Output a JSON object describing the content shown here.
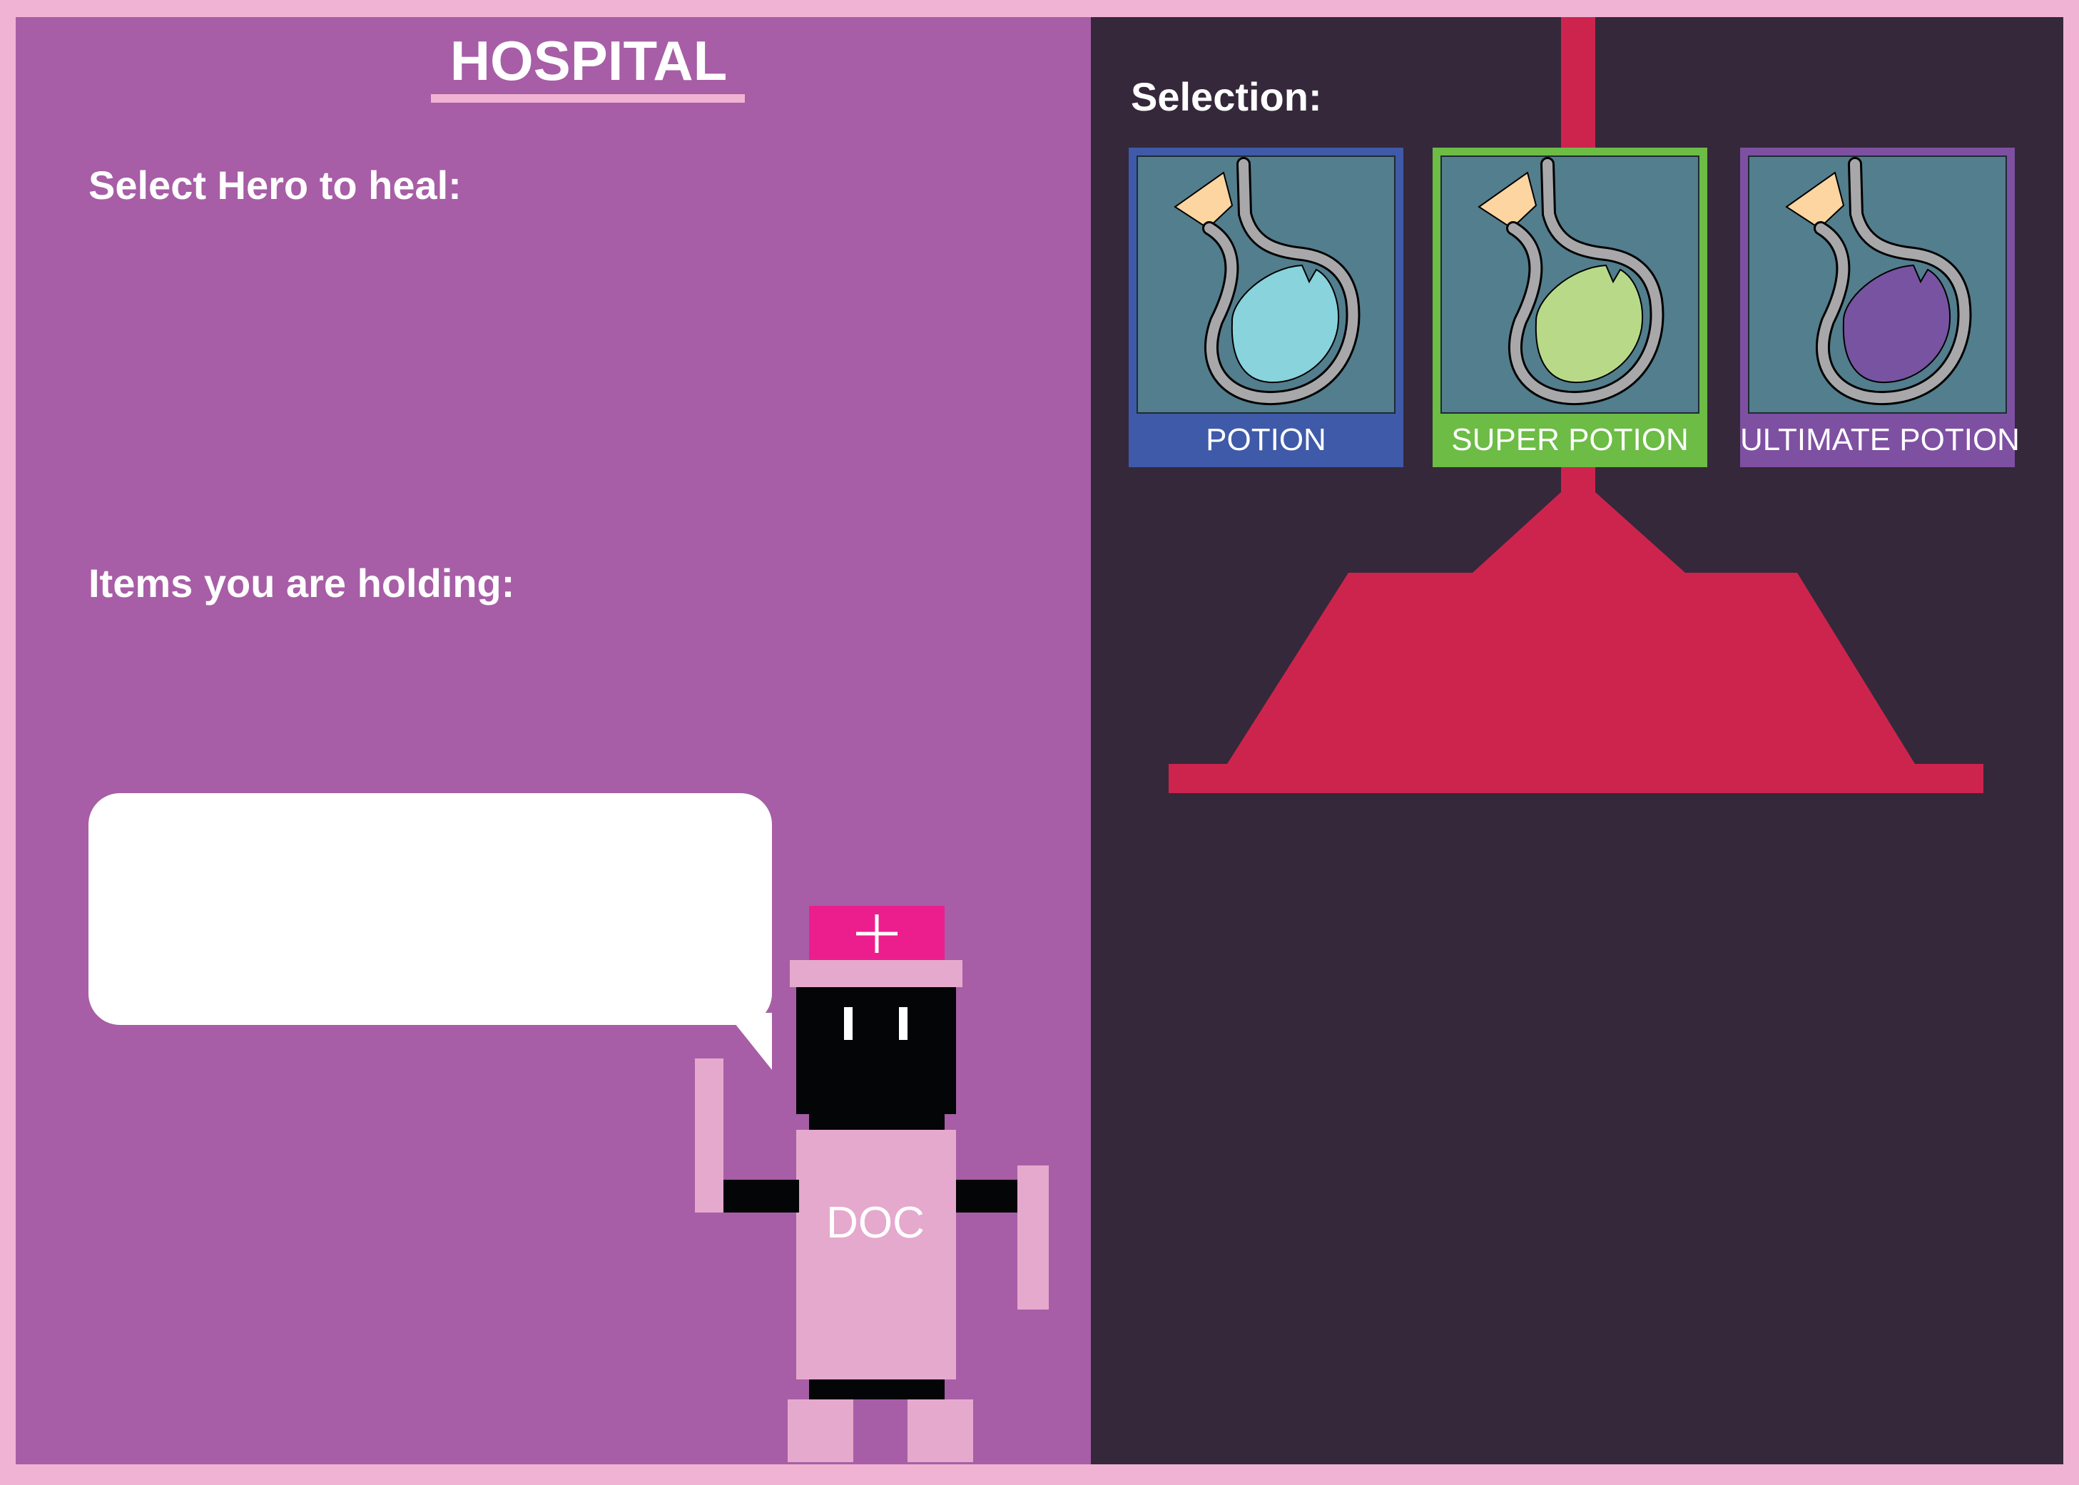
{
  "title": "HOSPITAL",
  "left": {
    "heal_label": "Select Hero to heal:",
    "items_label": "Items you are holding:"
  },
  "right": {
    "selection_label": "Selection:",
    "potions": [
      {
        "label": "POTION",
        "frame_color": "#3f5aa8",
        "liquid_color": "#88d3dc"
      },
      {
        "label": "SUPER POTION",
        "frame_color": "#6cbc45",
        "liquid_color": "#b8da88"
      },
      {
        "label": "ULTIMATE POTION",
        "frame_color": "#7e50a2",
        "liquid_color": "#7853a2"
      }
    ]
  },
  "doc": {
    "label": "DOC"
  },
  "colors": {
    "left_panel": "#a75ea6",
    "right_panel": "#35283a",
    "border": "#f0b3d3",
    "lamp": "#cd244e",
    "doc_body": "#e5a9cd",
    "doc_hat_top": "#ec1e8e"
  }
}
